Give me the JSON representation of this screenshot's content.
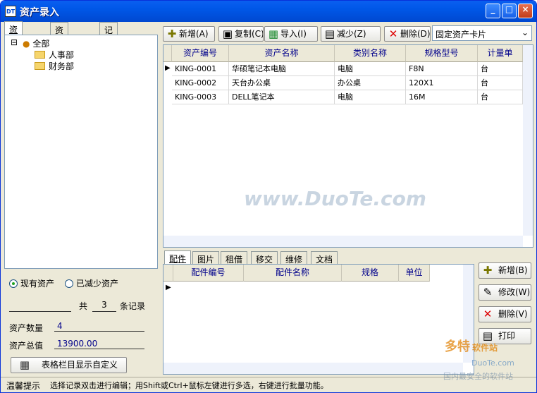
{
  "window": {
    "title": "资产录入",
    "minimize": "_",
    "maximize": "□",
    "close": "×"
  },
  "left_tabs": [
    "资产位置",
    "资产类别",
    "记录搜索"
  ],
  "tree": {
    "root": "全部",
    "children": [
      "人事部",
      "财务部"
    ],
    "expander": "⊟"
  },
  "filters": {
    "current": "现有资产",
    "reduced": "已减少资产"
  },
  "summary": {
    "prefix": "共",
    "count": "3",
    "suffix": "条记录",
    "quantity_label": "资产数量",
    "quantity": "4",
    "total_label": "资产总值",
    "total": "13900.00",
    "customize_button": "表格栏目显示自定义"
  },
  "toolbar": {
    "add": "新增(A)",
    "copy": "复制(C)",
    "import": "导入(I)",
    "reduce": "减少(Z)",
    "delete": "删除(D)",
    "card_type": "固定资产卡片"
  },
  "grid": {
    "columns": [
      "资产编号",
      "资产名称",
      "类别名称",
      "规格型号",
      "计量单"
    ],
    "rows": [
      [
        "KING-0001",
        "华硕笔记本电脑",
        "电脑",
        "F8N",
        "台"
      ],
      [
        "KING-0002",
        "天台办公桌",
        "办公桌",
        "120X1",
        "台"
      ],
      [
        "KING-0003",
        "DELL笔记本",
        "电脑",
        "16M",
        "台"
      ]
    ],
    "current_row_marker": "▶"
  },
  "bottom_tabs": [
    "配件",
    "图片",
    "租借",
    "移交",
    "维修",
    "文档"
  ],
  "parts_grid": {
    "columns": [
      "配件编号",
      "配件名称",
      "规格",
      "单位"
    ]
  },
  "parts_buttons": {
    "add": "新增(B)",
    "edit": "修改(W)",
    "delete": "删除(V)",
    "print": "打印"
  },
  "status": {
    "label": "温馨提示",
    "message": "选择记录双击进行编辑；用Shift或Ctrl+鼠标左键进行多选，右键进行批量功能。"
  },
  "watermarks": {
    "center": "www.DuoTe.com",
    "corner_brand": "多特",
    "corner_sub": "软件站",
    "corner_domain": "DuoTe.com",
    "corner_slogan": "国内最安全的软件站"
  }
}
